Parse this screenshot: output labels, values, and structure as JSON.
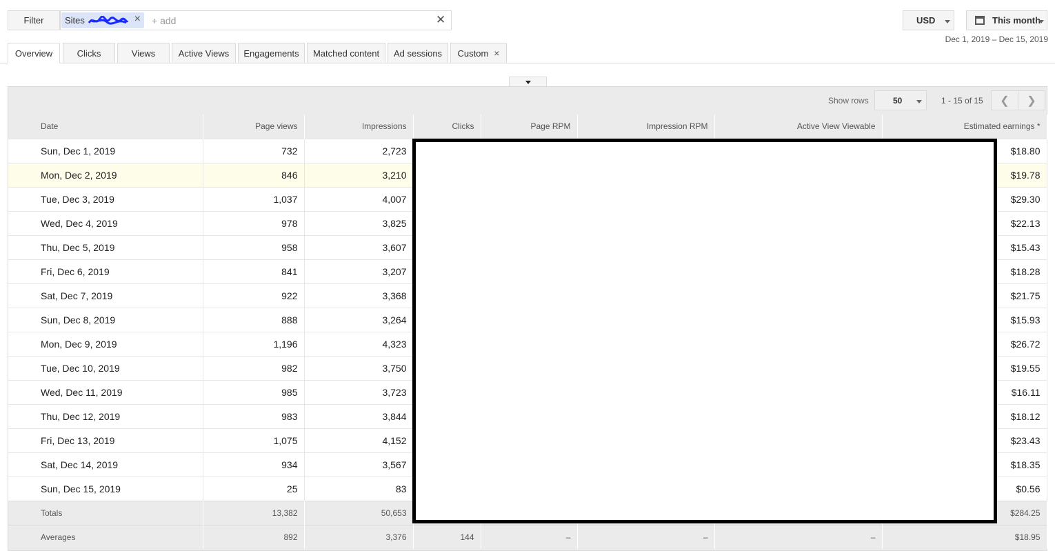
{
  "filter": {
    "button_label": "Filter",
    "chip_label": "Sites",
    "add_placeholder": "+ add"
  },
  "currency": "USD",
  "period": {
    "label": "This month",
    "range": "Dec 1, 2019 – Dec 15, 2019"
  },
  "tabs": [
    {
      "label": "Overview",
      "active": true
    },
    {
      "label": "Clicks"
    },
    {
      "label": "Views"
    },
    {
      "label": "Active Views"
    },
    {
      "label": "Engagements"
    },
    {
      "label": "Matched content"
    },
    {
      "label": "Ad sessions"
    },
    {
      "label": "Custom"
    }
  ],
  "pagination": {
    "show_rows_label": "Show rows",
    "rows": "50",
    "range": "1 - 15 of 15"
  },
  "table": {
    "columns": [
      "Date",
      "Page views",
      "Impressions",
      "Clicks",
      "Page RPM",
      "Impression RPM",
      "Active View Viewable",
      "Estimated earnings *"
    ],
    "rows": [
      [
        "Sun, Dec 1, 2019",
        "732",
        "2,723",
        "$18.80"
      ],
      [
        "Mon, Dec 2, 2019",
        "846",
        "3,210",
        "$19.78"
      ],
      [
        "Tue, Dec 3, 2019",
        "1,037",
        "4,007",
        "$29.30"
      ],
      [
        "Wed, Dec 4, 2019",
        "978",
        "3,825",
        "$22.13"
      ],
      [
        "Thu, Dec 5, 2019",
        "958",
        "3,607",
        "$15.43"
      ],
      [
        "Fri, Dec 6, 2019",
        "841",
        "3,207",
        "$18.28"
      ],
      [
        "Sat, Dec 7, 2019",
        "922",
        "3,368",
        "$21.75"
      ],
      [
        "Sun, Dec 8, 2019",
        "888",
        "3,264",
        "$15.93"
      ],
      [
        "Mon, Dec 9, 2019",
        "1,196",
        "4,323",
        "$26.72"
      ],
      [
        "Tue, Dec 10, 2019",
        "982",
        "3,750",
        "$19.55"
      ],
      [
        "Wed, Dec 11, 2019",
        "985",
        "3,723",
        "$16.11"
      ],
      [
        "Thu, Dec 12, 2019",
        "983",
        "3,844",
        "$18.12"
      ],
      [
        "Fri, Dec 13, 2019",
        "1,075",
        "4,152",
        "$23.43"
      ],
      [
        "Sat, Dec 14, 2019",
        "934",
        "3,567",
        "$18.35"
      ],
      [
        "Sun, Dec 15, 2019",
        "25",
        "83",
        "$0.56"
      ]
    ],
    "totals": [
      "Totals",
      "13,382",
      "50,653",
      "",
      "",
      "",
      "",
      "$284.25"
    ],
    "averages": [
      "Averages",
      "892",
      "3,376",
      "144",
      "–",
      "–",
      "–",
      "$18.95"
    ]
  },
  "icons": {
    "chip_close": "close-icon",
    "clear": "close-icon",
    "calendar": "calendar-icon",
    "prev": "chevron-left-icon",
    "next": "chevron-right-icon"
  }
}
